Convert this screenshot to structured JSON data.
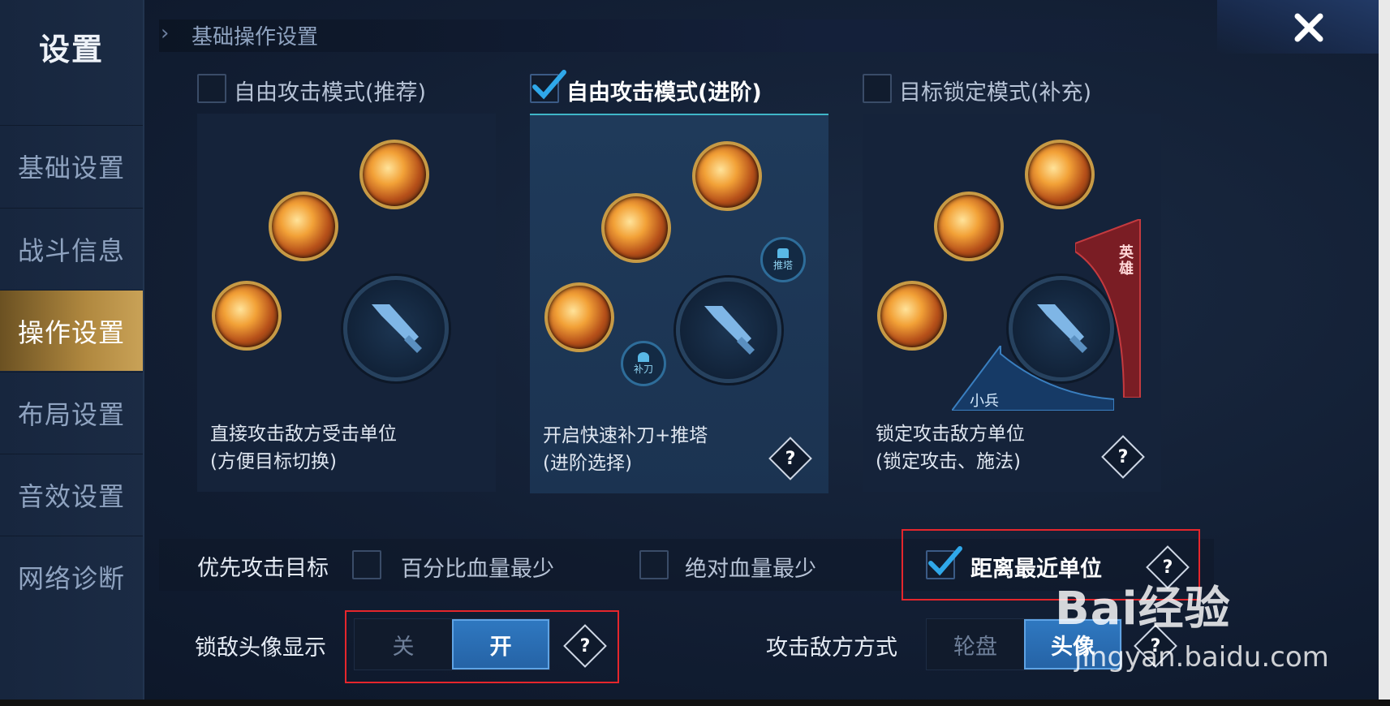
{
  "sidebar": {
    "title": "设置",
    "items": [
      {
        "label": "基础设置",
        "active": false
      },
      {
        "label": "战斗信息",
        "active": false
      },
      {
        "label": "操作设置",
        "active": true
      },
      {
        "label": "布局设置",
        "active": false
      },
      {
        "label": "音效设置",
        "active": false
      },
      {
        "label": "网络诊断",
        "active": false
      }
    ]
  },
  "header": {
    "title": "基础操作设置",
    "close_icon": "close-icon"
  },
  "modes": [
    {
      "label": "自由攻击模式(推荐)",
      "checked": false,
      "desc_line1": "直接攻击敌方受击单位",
      "desc_line2": "(方便目标切换)"
    },
    {
      "label": "自由攻击模式(进阶)",
      "checked": true,
      "desc_line1": "开启快速补刀+推塔",
      "desc_line2": "(进阶选择)",
      "badge_tower": "推塔",
      "badge_lasthit": "补刀"
    },
    {
      "label": "目标锁定模式(补充)",
      "checked": false,
      "desc_line1": "锁定攻击敌方单位",
      "desc_line2": "(锁定攻击、施法)",
      "badge_hero": "英雄",
      "badge_minion": "小兵"
    }
  ],
  "priority": {
    "label": "优先攻击目标",
    "options": [
      {
        "label": "百分比血量最少",
        "checked": false
      },
      {
        "label": "绝对血量最少",
        "checked": false
      },
      {
        "label": "距离最近单位",
        "checked": true
      }
    ]
  },
  "lock_avatar": {
    "label": "锁敌头像显示",
    "off": "关",
    "on": "开",
    "value": "开"
  },
  "attack_method": {
    "label": "攻击敌方方式",
    "opt1": "轮盘",
    "opt2": "头像",
    "value": "头像"
  },
  "help_symbol": "?",
  "watermark": {
    "line1": "Bai经验",
    "line2": "jingyan.baidu.com"
  },
  "colors": {
    "accent_gold": "#c9a257",
    "accent_blue": "#2f78c0",
    "highlight_red": "#e5262c"
  }
}
